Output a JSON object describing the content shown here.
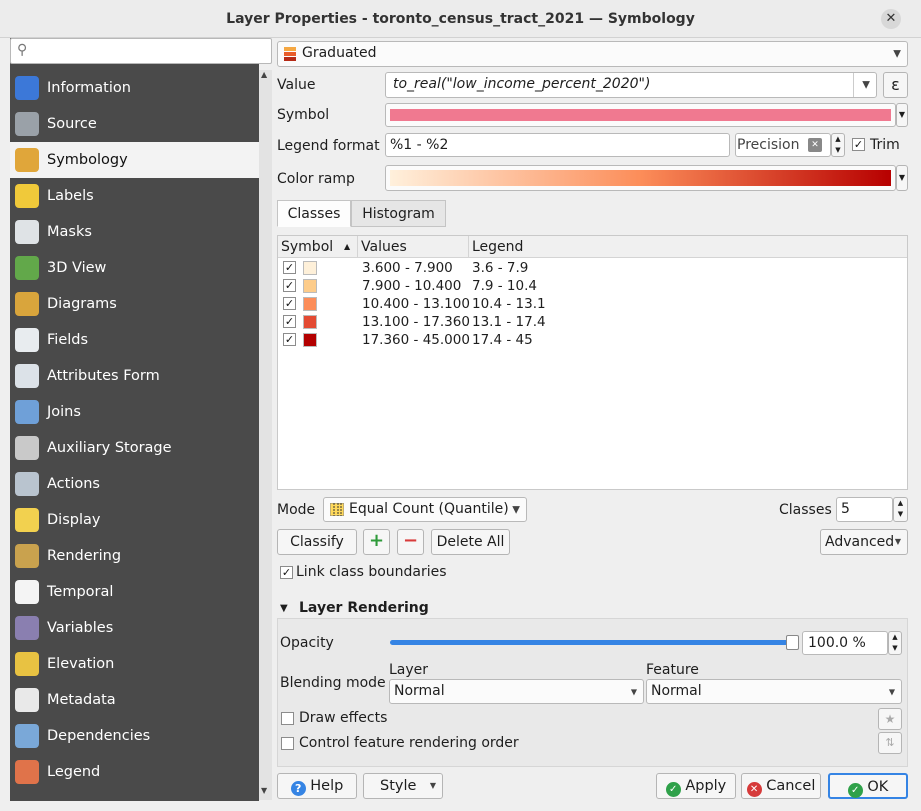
{
  "window": {
    "title": "Layer Properties - toronto_census_tract_2021 — Symbology",
    "close": "✕"
  },
  "sidebar": {
    "items": [
      {
        "label": "Information",
        "icon": "information-icon",
        "color": "#3c78d8"
      },
      {
        "label": "Source",
        "icon": "source-icon",
        "color": "#9aa1a8"
      },
      {
        "label": "Symbology",
        "icon": "symbology-icon",
        "color": "#e0a63a"
      },
      {
        "label": "Labels",
        "icon": "labels-icon",
        "color": "#f0c93a"
      },
      {
        "label": "Masks",
        "icon": "masks-icon",
        "color": "#dfe3e6"
      },
      {
        "label": "3D View",
        "icon": "3d-view-icon",
        "color": "#62a84a"
      },
      {
        "label": "Diagrams",
        "icon": "diagrams-icon",
        "color": "#d9a53c"
      },
      {
        "label": "Fields",
        "icon": "fields-icon",
        "color": "#e8ecef"
      },
      {
        "label": "Attributes Form",
        "icon": "attributes-form-icon",
        "color": "#dce2e8"
      },
      {
        "label": "Joins",
        "icon": "joins-icon",
        "color": "#6fa0d8"
      },
      {
        "label": "Auxiliary Storage",
        "icon": "auxiliary-storage-icon",
        "color": "#c9c9c9"
      },
      {
        "label": "Actions",
        "icon": "actions-icon",
        "color": "#b9c4cf"
      },
      {
        "label": "Display",
        "icon": "display-icon",
        "color": "#f2d14f"
      },
      {
        "label": "Rendering",
        "icon": "rendering-icon",
        "color": "#c9a24e"
      },
      {
        "label": "Temporal",
        "icon": "temporal-icon",
        "color": "#f4f4f4"
      },
      {
        "label": "Variables",
        "icon": "variables-icon",
        "color": "#8a7fb0"
      },
      {
        "label": "Elevation",
        "icon": "elevation-icon",
        "color": "#e8c242"
      },
      {
        "label": "Metadata",
        "icon": "metadata-icon",
        "color": "#e9e9e9"
      },
      {
        "label": "Dependencies",
        "icon": "dependencies-icon",
        "color": "#7aa8d8"
      },
      {
        "label": "Legend",
        "icon": "legend-icon",
        "color": "#e0734a"
      }
    ],
    "selected": "Symbology"
  },
  "renderer": {
    "type": "Graduated"
  },
  "value": {
    "label": "Value",
    "expression": "to_real(\"low_income_percent_2020\")",
    "epsilon": "ε"
  },
  "symbol": {
    "label": "Symbol",
    "color": "#f07990"
  },
  "legend_format": {
    "label": "Legend format",
    "value": "%1 - %2",
    "precision_placeholder": "Precision",
    "trim_label": "Trim",
    "trim_checked": "✓"
  },
  "color_ramp": {
    "label": "Color ramp",
    "start": "#fff0dc",
    "mid": "#fc8d59",
    "end": "#b70000"
  },
  "tabs": {
    "classes": "Classes",
    "histogram": "Histogram"
  },
  "table": {
    "headers": {
      "symbol": "Symbol",
      "values": "Values",
      "legend": "Legend",
      "sort": "▲"
    },
    "rows": [
      {
        "checked": "✓",
        "color": "#fef0d9",
        "values": "3.600 - 7.900",
        "legend": "3.6 - 7.9"
      },
      {
        "checked": "✓",
        "color": "#fdcc8a",
        "values": "7.900 - 10.400",
        "legend": "7.9 - 10.4"
      },
      {
        "checked": "✓",
        "color": "#fc8d59",
        "values": "10.400 - 13.100",
        "legend": "10.4 - 13.1"
      },
      {
        "checked": "✓",
        "color": "#e34a33",
        "values": "13.100 - 17.360",
        "legend": "13.1 - 17.4"
      },
      {
        "checked": "✓",
        "color": "#b30000",
        "values": "17.360 - 45.000",
        "legend": "17.4 - 45"
      }
    ]
  },
  "mode": {
    "label": "Mode",
    "value": "Equal Count (Quantile)"
  },
  "classes": {
    "label": "Classes",
    "value": "5"
  },
  "buttons": {
    "classify": "Classify",
    "add": "+",
    "remove": "−",
    "delete_all": "Delete All",
    "advanced": "Advanced"
  },
  "link_class": {
    "label": "Link class boundaries",
    "checked": "✓"
  },
  "layer_rendering": {
    "title": "Layer Rendering",
    "opacity_label": "Opacity",
    "opacity_value": "100.0 %",
    "blending_label": "Blending mode",
    "layer_label": "Layer",
    "feature_label": "Feature",
    "layer_blend": "Normal",
    "feature_blend": "Normal",
    "draw_effects": "Draw effects",
    "control_order": "Control feature rendering order"
  },
  "footer": {
    "help": "Help",
    "style": "Style",
    "apply": "Apply",
    "cancel": "Cancel",
    "ok": "OK"
  },
  "colors": {
    "accent": "#3584e4",
    "sidebar_bg": "#4a4a4a",
    "ok_green": "#2fa14a",
    "cancel_red": "#d63a3a"
  }
}
